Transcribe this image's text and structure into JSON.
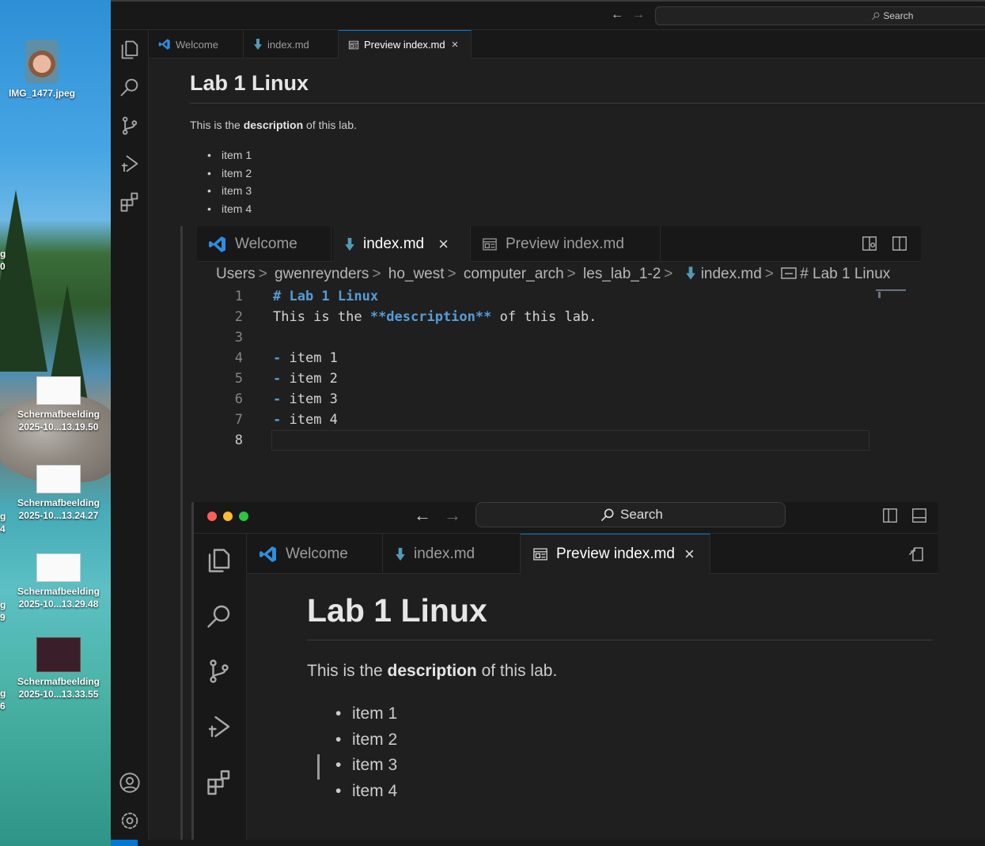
{
  "desktop": {
    "photo_label": "IMG_1477.jpeg",
    "screenshots": [
      {
        "name": "Schermafbeelding",
        "date": "2025-10...13.19.50"
      },
      {
        "name": "Schermafbeelding",
        "date": "2025-10...13.24.27"
      },
      {
        "name": "Schermafbeelding",
        "date": "2025-10...13.29.48"
      },
      {
        "name": "Schermafbeelding",
        "date": "2025-10...13.33.55"
      }
    ],
    "cut_labels": [
      "g",
      "0",
      "g",
      "4",
      "g",
      "9",
      "g",
      "6"
    ]
  },
  "window": {
    "search_label": "Search",
    "tabs": [
      {
        "label": "Welcome"
      },
      {
        "label": "index.md"
      },
      {
        "label": "Preview index.md"
      }
    ],
    "close_glyph": "×"
  },
  "preview": {
    "title": "Lab 1 Linux",
    "para_prefix": "This is the ",
    "para_bold": "description",
    "para_suffix": " of this lab.",
    "items": [
      "item 1",
      "item 2",
      "item 3",
      "item 4"
    ]
  },
  "editor_shot": {
    "tabs": [
      {
        "label": "Welcome"
      },
      {
        "label": "index.md"
      },
      {
        "label": "Preview index.md"
      }
    ],
    "close_glyph": "×",
    "breadcrumbs": [
      "Users",
      "gwenreynders",
      "ho_west",
      "computer_arch",
      "les_lab_1-2",
      "index.md",
      "# Lab 1 Linux"
    ],
    "lines": [
      {
        "n": "1",
        "pre": "",
        "kw": "# Lab 1 Linux",
        "post": ""
      },
      {
        "n": "2",
        "pre": "This is the ",
        "kw": "**description**",
        "post": " of this lab."
      },
      {
        "n": "3",
        "pre": "",
        "kw": "",
        "post": ""
      },
      {
        "n": "4",
        "pre": "",
        "kw": "-",
        "post": " item 1"
      },
      {
        "n": "5",
        "pre": "",
        "kw": "-",
        "post": " item 2"
      },
      {
        "n": "6",
        "pre": "",
        "kw": "-",
        "post": " item 3"
      },
      {
        "n": "7",
        "pre": "",
        "kw": "-",
        "post": " item 4"
      },
      {
        "n": "8",
        "pre": "",
        "kw": "",
        "post": ""
      }
    ]
  },
  "nested_shot": {
    "search_label": "Search",
    "tabs": [
      {
        "label": "Welcome"
      },
      {
        "label": "index.md"
      },
      {
        "label": "Preview index.md"
      }
    ],
    "close_glyph": "×",
    "title": "Lab 1 Linux",
    "para_prefix": "This is the ",
    "para_bold": "description",
    "para_suffix": " of this lab.",
    "items": [
      "item 1",
      "item 2",
      "item 3",
      "item 4"
    ]
  },
  "colors": {
    "accent": "#0078d4",
    "markdown_keyword": "#569cd6",
    "vscode_blue": "#2e8ee0",
    "md_arrow": "#519aba"
  },
  "icons": [
    "explorer-icon",
    "search-icon",
    "source-control-icon",
    "run-debug-icon",
    "extensions-icon",
    "account-icon",
    "settings-gear-icon"
  ]
}
